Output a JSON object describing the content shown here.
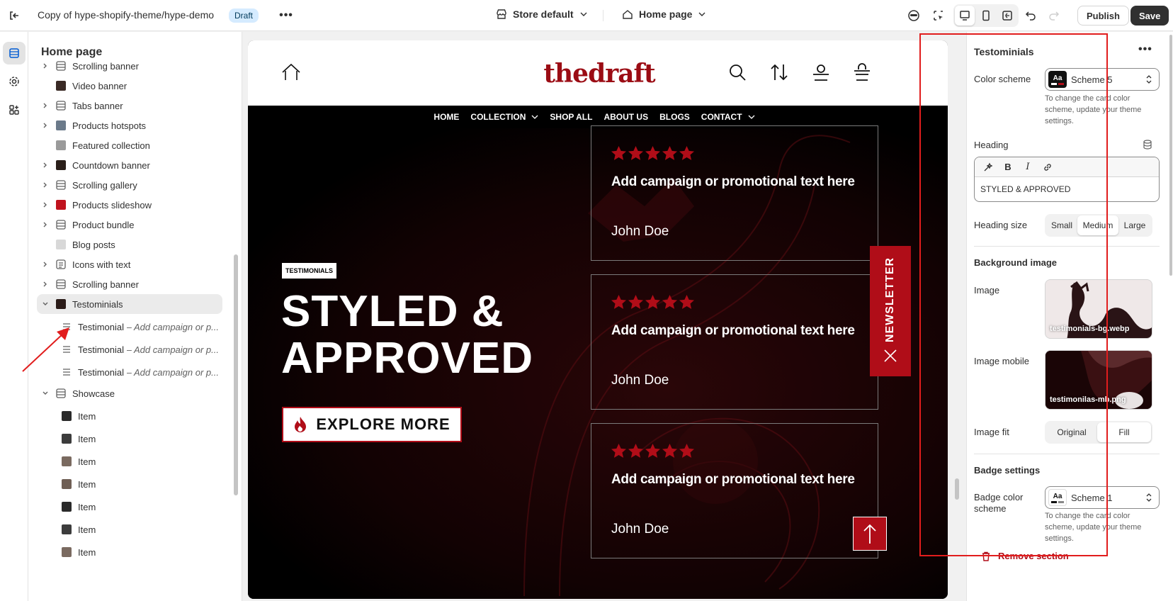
{
  "topbar": {
    "theme_name": "Copy of hype-shopify-theme/hype-demo",
    "status_badge": "Draft",
    "store_selector": "Store default",
    "page_selector": "Home page",
    "publish_label": "Publish",
    "save_label": "Save"
  },
  "sidebar": {
    "title": "Home page",
    "items": [
      {
        "label": "Scrolling banner"
      },
      {
        "label": "Video banner"
      },
      {
        "label": "Tabs banner"
      },
      {
        "label": "Products hotspots"
      },
      {
        "label": "Featured collection"
      },
      {
        "label": "Countdown banner"
      },
      {
        "label": "Scrolling gallery"
      },
      {
        "label": "Products slideshow"
      },
      {
        "label": "Product bundle"
      },
      {
        "label": "Blog posts"
      },
      {
        "label": "Icons with text"
      },
      {
        "label": "Scrolling banner"
      },
      {
        "label": "Testominials"
      },
      {
        "label": "Testimonial",
        "sub": "– Add campaign or p..."
      },
      {
        "label": "Testimonial",
        "sub": "– Add campaign or p..."
      },
      {
        "label": "Testimonial",
        "sub": "– Add campaign or p..."
      },
      {
        "label": "Showcase"
      },
      {
        "label": "Item"
      },
      {
        "label": "Item"
      },
      {
        "label": "Item"
      },
      {
        "label": "Item"
      },
      {
        "label": "Item"
      },
      {
        "label": "Item"
      },
      {
        "label": "Item"
      }
    ]
  },
  "preview": {
    "logo": "thedraft",
    "nav": [
      "HOME",
      "COLLECTION",
      "SHOP ALL",
      "ABOUT US",
      "BLOGS",
      "CONTACT"
    ],
    "tag": "TESTIMONIALS",
    "heading_line1": "STYLED &",
    "heading_line2": "APPROVED",
    "button_label": "EXPLORE MORE",
    "cards": [
      {
        "text": "Add campaign or promotional text here",
        "name": "John Doe",
        "rating": 5
      },
      {
        "text": "Add campaign or promotional text here",
        "name": "John Doe",
        "rating": 5
      },
      {
        "text": "Add campaign or promotional text here",
        "name": "John Doe",
        "rating": 5
      }
    ],
    "newsletter_label": "NEWSLETTER"
  },
  "settings": {
    "title": "Testominials",
    "color_scheme_label": "Color scheme",
    "color_scheme_value": "Scheme 5",
    "color_scheme_help": "To change the card color scheme, update your theme settings.",
    "heading_label": "Heading",
    "heading_value": "STYLED & APPROVED",
    "heading_size_label": "Heading size",
    "heading_size_options": [
      "Small",
      "Medium",
      "Large"
    ],
    "heading_size_selected": "Medium",
    "bg_section": "Background image",
    "image_label": "Image",
    "image_file": "testimonials-bg.webp",
    "image_mobile_label": "Image mobile",
    "image_mobile_file": "testimonilas-mb.png",
    "image_fit_label": "Image fit",
    "image_fit_options": [
      "Original",
      "Fill"
    ],
    "image_fit_selected": "Fill",
    "badge_section": "Badge settings",
    "badge_color_label": "Badge color scheme",
    "badge_color_value": "Scheme 1",
    "badge_help": "To change the card color scheme, update your theme settings.",
    "remove_label": "Remove section"
  },
  "colors": {
    "accent": "#b00d18",
    "annotation": "#e11d1d",
    "draft_badge": "#d5ebff"
  }
}
